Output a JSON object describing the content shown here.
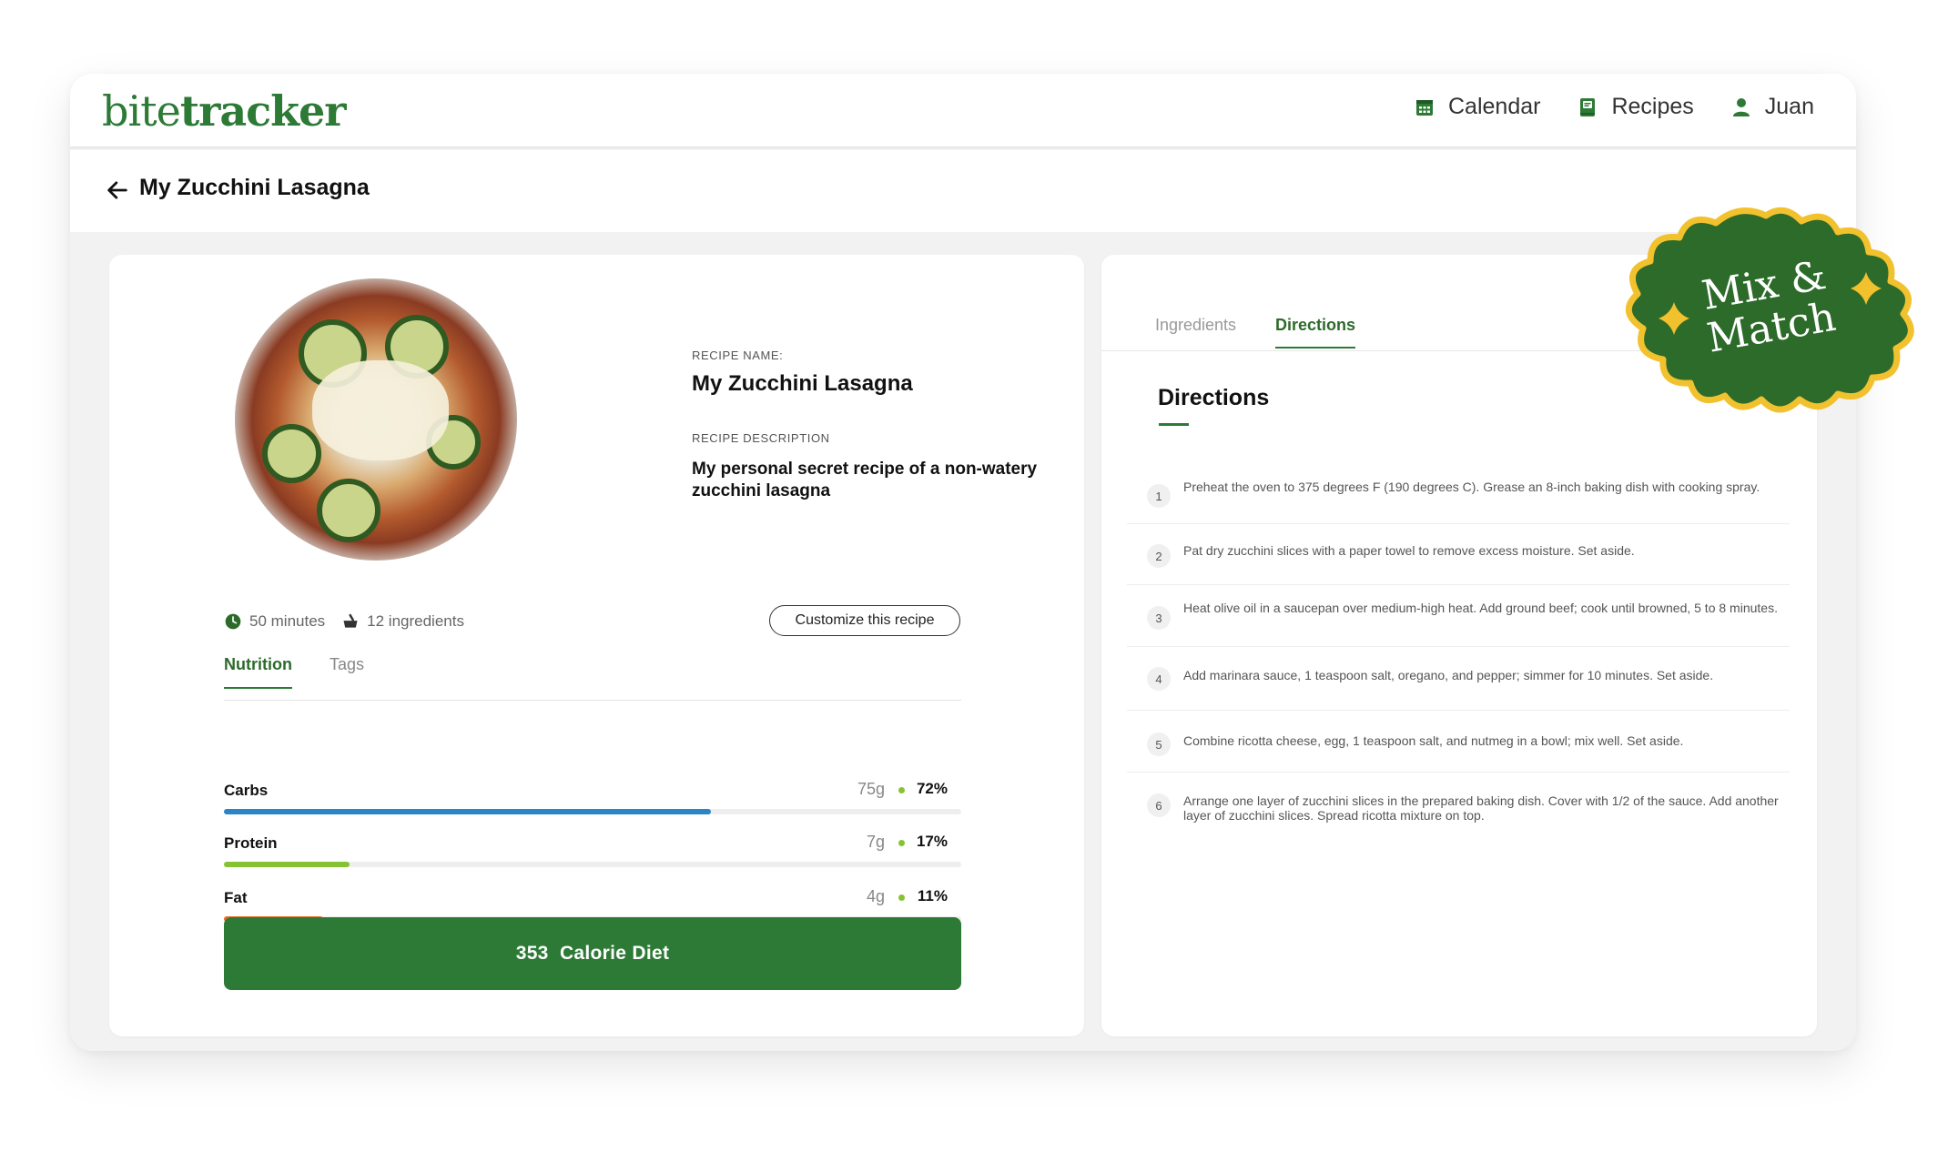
{
  "app": {
    "logo_light": "bite",
    "logo_bold": "tracker",
    "nav": [
      {
        "label": "Calendar",
        "icon": "calendar-icon"
      },
      {
        "label": "Recipes",
        "icon": "book-icon"
      },
      {
        "label": "Juan",
        "icon": "user-icon"
      }
    ]
  },
  "page": {
    "title": "My Zucchini Lasagna"
  },
  "recipe": {
    "name_label": "RECIPE NAME:",
    "name": "My Zucchini Lasagna",
    "desc_label": "RECIPE DESCRIPTION",
    "description": "My personal secret recipe of a non-watery zucchini lasagna",
    "time": "50 minutes",
    "ingredients_count": "12 ingredients",
    "customize_label": "Customize this recipe"
  },
  "left_tabs": [
    {
      "label": "Nutrition",
      "active": true
    },
    {
      "label": "Tags",
      "active": false
    }
  ],
  "nutrition": [
    {
      "name": "Carbs",
      "grams": "75g",
      "percent": "72%",
      "fill": 0.66,
      "color": "#2a85c4"
    },
    {
      "name": "Protein",
      "grams": "7g",
      "percent": "17%",
      "fill": 0.17,
      "color": "#86c332"
    },
    {
      "name": "Fat",
      "grams": "4g",
      "percent": "11%",
      "fill": 0.135,
      "color": "#ea6a22"
    }
  ],
  "calorie_button": {
    "value": "353",
    "label": "Calorie Diet"
  },
  "right_tabs": [
    {
      "label": "Ingredients",
      "active": false
    },
    {
      "label": "Directions",
      "active": true
    }
  ],
  "directions": {
    "title": "Directions",
    "steps": [
      {
        "num": "1",
        "text": "Preheat the oven to 375 degrees F (190 degrees C). Grease an 8-inch baking dish with cooking spray."
      },
      {
        "num": "2",
        "text": "Pat dry zucchini slices with a paper towel to remove excess moisture. Set aside."
      },
      {
        "num": "3",
        "text": "Heat olive oil in a saucepan over medium-high heat. Add ground beef; cook until browned, 5 to 8 minutes."
      },
      {
        "num": "4",
        "text": "Add marinara sauce, 1 teaspoon salt, oregano, and pepper; simmer for 10 minutes. Set aside."
      },
      {
        "num": "5",
        "text": "Combine ricotta cheese, egg, 1 teaspoon salt, and nutmeg in a bowl; mix well. Set aside."
      },
      {
        "num": "6",
        "text": "Arrange one layer of zucchini slices in the prepared baking dish. Cover with 1/2 of the sauce. Add another layer of zucchini slices. Spread ricotta mixture on top."
      }
    ]
  },
  "badge": {
    "line1": "Mix &",
    "line2": "Match",
    "bg_color": "#2d6b2a",
    "border_color": "#f2c12e"
  },
  "colors": {
    "brand_green": "#2d7a36"
  }
}
